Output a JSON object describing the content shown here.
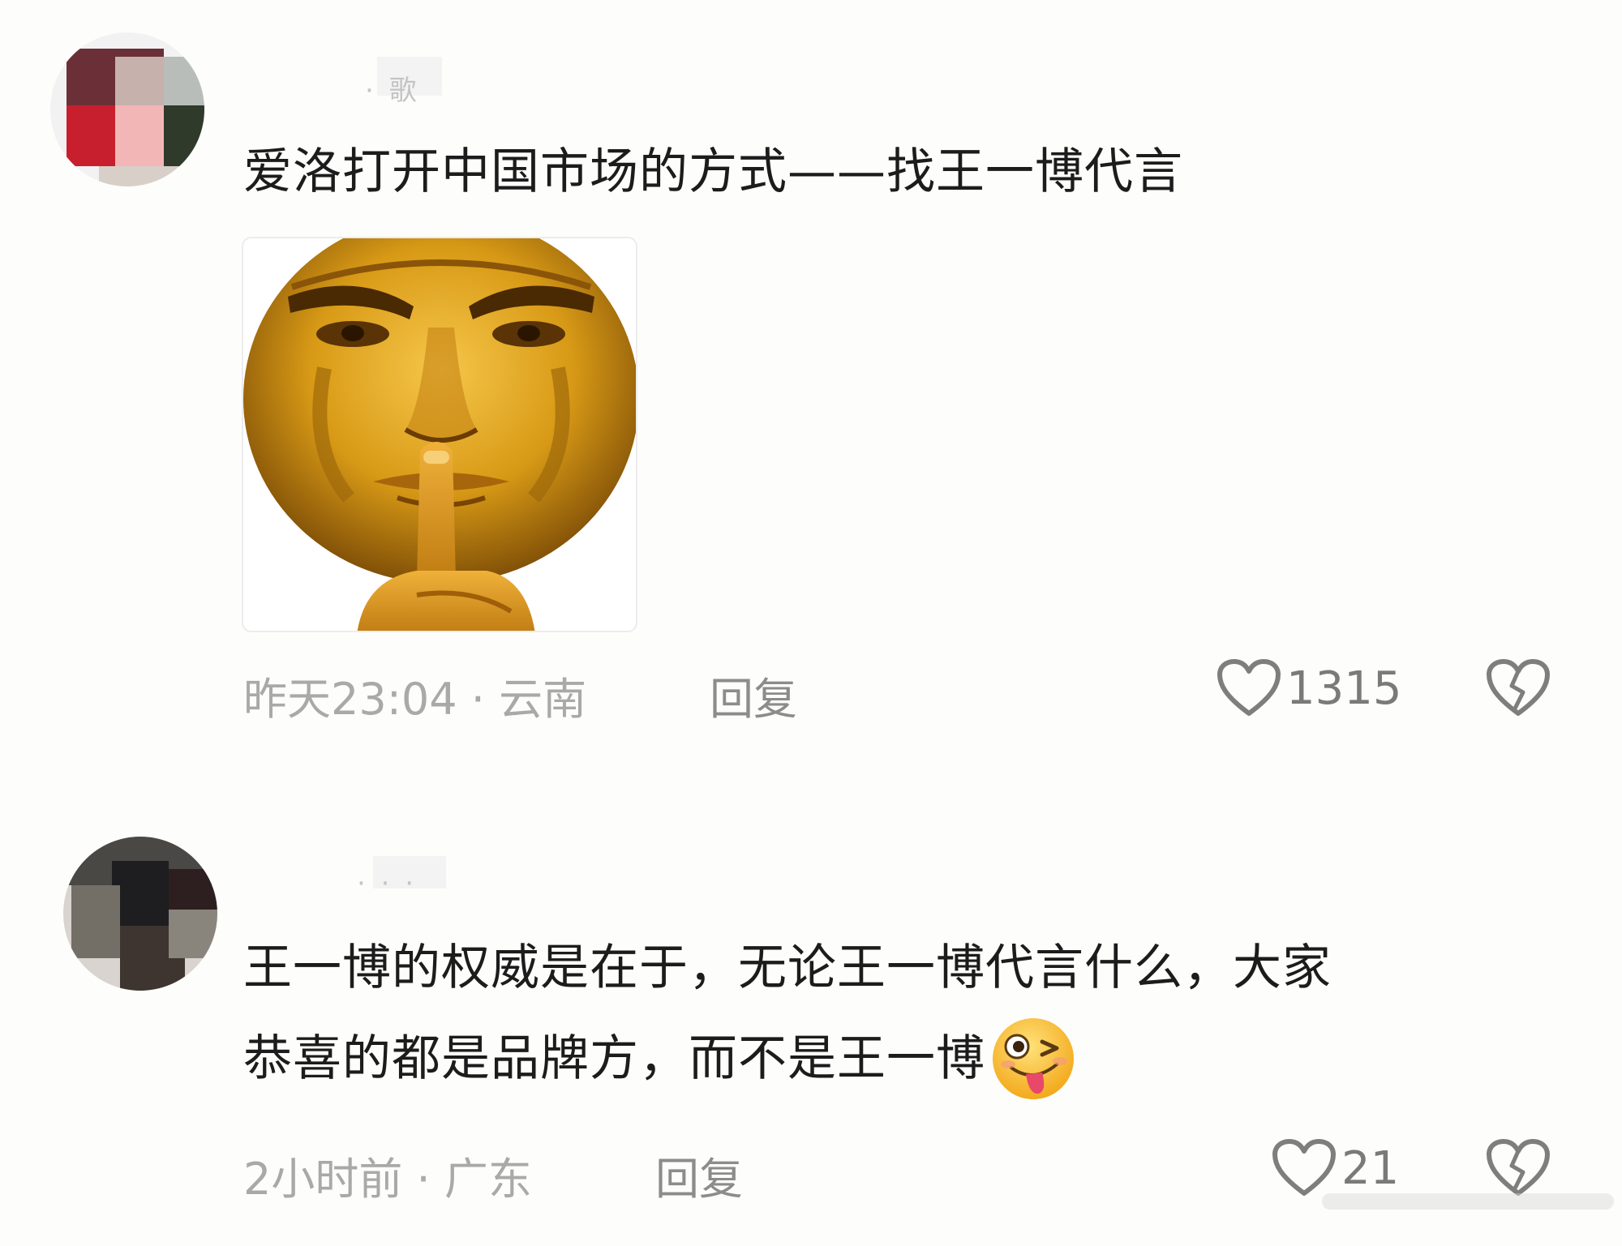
{
  "comments": [
    {
      "username": "· 歌",
      "text": "爱洛打开中国市场的方式——找王一博代言",
      "meta": "昨天23:04 · 云南",
      "reply_label": "回复",
      "like_count": "1315",
      "avatar_icon": "pixelated-avatar",
      "image_icon": "golden-face-shush-meme"
    },
    {
      "username": "· · ·",
      "text_line1": "王一博的权威是在于，无论王一博代言什么，大家",
      "text_line2": "恭喜的都是品牌方，而不是王一博",
      "meta": "2小时前 · 广东",
      "reply_label": "回复",
      "like_count": "21",
      "avatar_icon": "pixelated-avatar",
      "emoji_icon": "wink-tongue-emoji"
    }
  ],
  "icons": {
    "like": "heart-outline-icon",
    "dislike": "broken-heart-icon"
  },
  "colors": {
    "background": "#fdfdfb",
    "text": "#1c1c1c",
    "meta": "#a9a9a9",
    "gold": "#d9a21a"
  }
}
